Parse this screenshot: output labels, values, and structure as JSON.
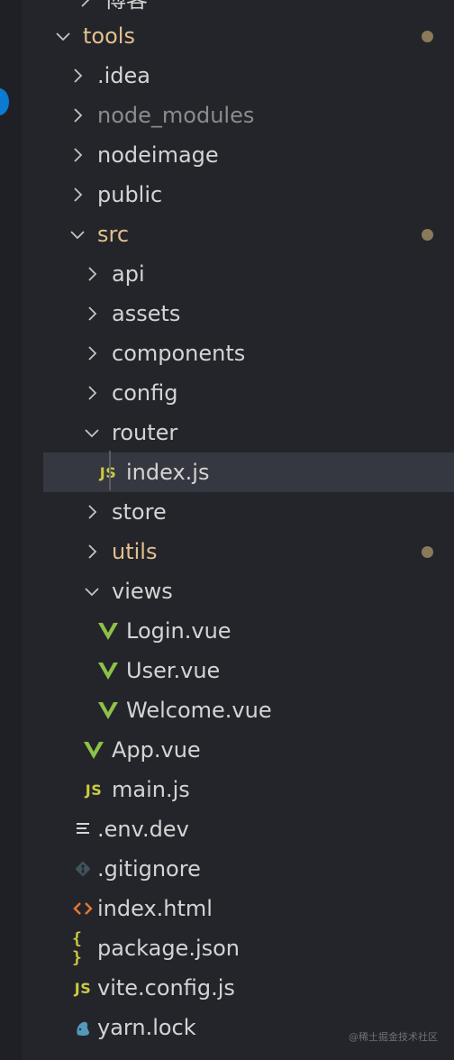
{
  "explorer": {
    "partial_top": "博客",
    "tree": [
      {
        "name": "tools",
        "type": "folder",
        "depth": 0,
        "open": true,
        "modified": true
      },
      {
        "name": ".idea",
        "type": "folder",
        "depth": 1,
        "open": false
      },
      {
        "name": "node_modules",
        "type": "folder",
        "depth": 1,
        "open": false,
        "ignored": true
      },
      {
        "name": "nodeimage",
        "type": "folder",
        "depth": 1,
        "open": false
      },
      {
        "name": "public",
        "type": "folder",
        "depth": 1,
        "open": false
      },
      {
        "name": "src",
        "type": "folder",
        "depth": 1,
        "open": true,
        "modified": true
      },
      {
        "name": "api",
        "type": "folder",
        "depth": 2,
        "open": false
      },
      {
        "name": "assets",
        "type": "folder",
        "depth": 2,
        "open": false
      },
      {
        "name": "components",
        "type": "folder",
        "depth": 2,
        "open": false
      },
      {
        "name": "config",
        "type": "folder",
        "depth": 2,
        "open": false
      },
      {
        "name": "router",
        "type": "folder",
        "depth": 2,
        "open": true
      },
      {
        "name": "index.js",
        "type": "file",
        "icon": "js",
        "depth": 3,
        "selected": true
      },
      {
        "name": "store",
        "type": "folder",
        "depth": 2,
        "open": false
      },
      {
        "name": "utils",
        "type": "folder",
        "depth": 2,
        "open": false,
        "modified": true
      },
      {
        "name": "views",
        "type": "folder",
        "depth": 2,
        "open": true
      },
      {
        "name": "Login.vue",
        "type": "file",
        "icon": "vue",
        "depth": 3
      },
      {
        "name": "User.vue",
        "type": "file",
        "icon": "vue",
        "depth": 3
      },
      {
        "name": "Welcome.vue",
        "type": "file",
        "icon": "vue",
        "depth": 3
      },
      {
        "name": "App.vue",
        "type": "file",
        "icon": "vue",
        "depth": 2
      },
      {
        "name": "main.js",
        "type": "file",
        "icon": "js",
        "depth": 2
      },
      {
        "name": ".env.dev",
        "type": "file",
        "icon": "lines",
        "depth": 1
      },
      {
        "name": ".gitignore",
        "type": "file",
        "icon": "git",
        "depth": 1
      },
      {
        "name": "index.html",
        "type": "file",
        "icon": "html",
        "depth": 1
      },
      {
        "name": "package.json",
        "type": "file",
        "icon": "json",
        "depth": 1
      },
      {
        "name": "vite.config.js",
        "type": "file",
        "icon": "js",
        "depth": 1
      },
      {
        "name": "yarn.lock",
        "type": "file",
        "icon": "yarn",
        "depth": 1
      }
    ]
  },
  "icons": {
    "js": {
      "name": "js-icon",
      "text": "JS",
      "color": "#cbcb41"
    },
    "json": {
      "name": "json-icon",
      "text": "{ }",
      "color": "#cbcb41"
    },
    "vue": {
      "name": "vue-icon",
      "color": "#8dc149"
    },
    "html": {
      "name": "html-icon",
      "color": "#e37933"
    },
    "git": {
      "name": "git-icon",
      "color": "#41535b"
    },
    "lines": {
      "name": "env-file-icon",
      "color": "#d4d7d6"
    },
    "yarn": {
      "name": "yarn-icon",
      "color": "#519aba"
    }
  },
  "colors": {
    "background": "#24252b",
    "text": "#d4d4d4",
    "modified_text": "#e3c08d",
    "ignored_text": "#8c8c8c",
    "modified_dot": "#8a7a5a",
    "selected_row": "#363841",
    "badge": "#0b7bd1"
  },
  "watermark": "@稀土掘金技术社区"
}
